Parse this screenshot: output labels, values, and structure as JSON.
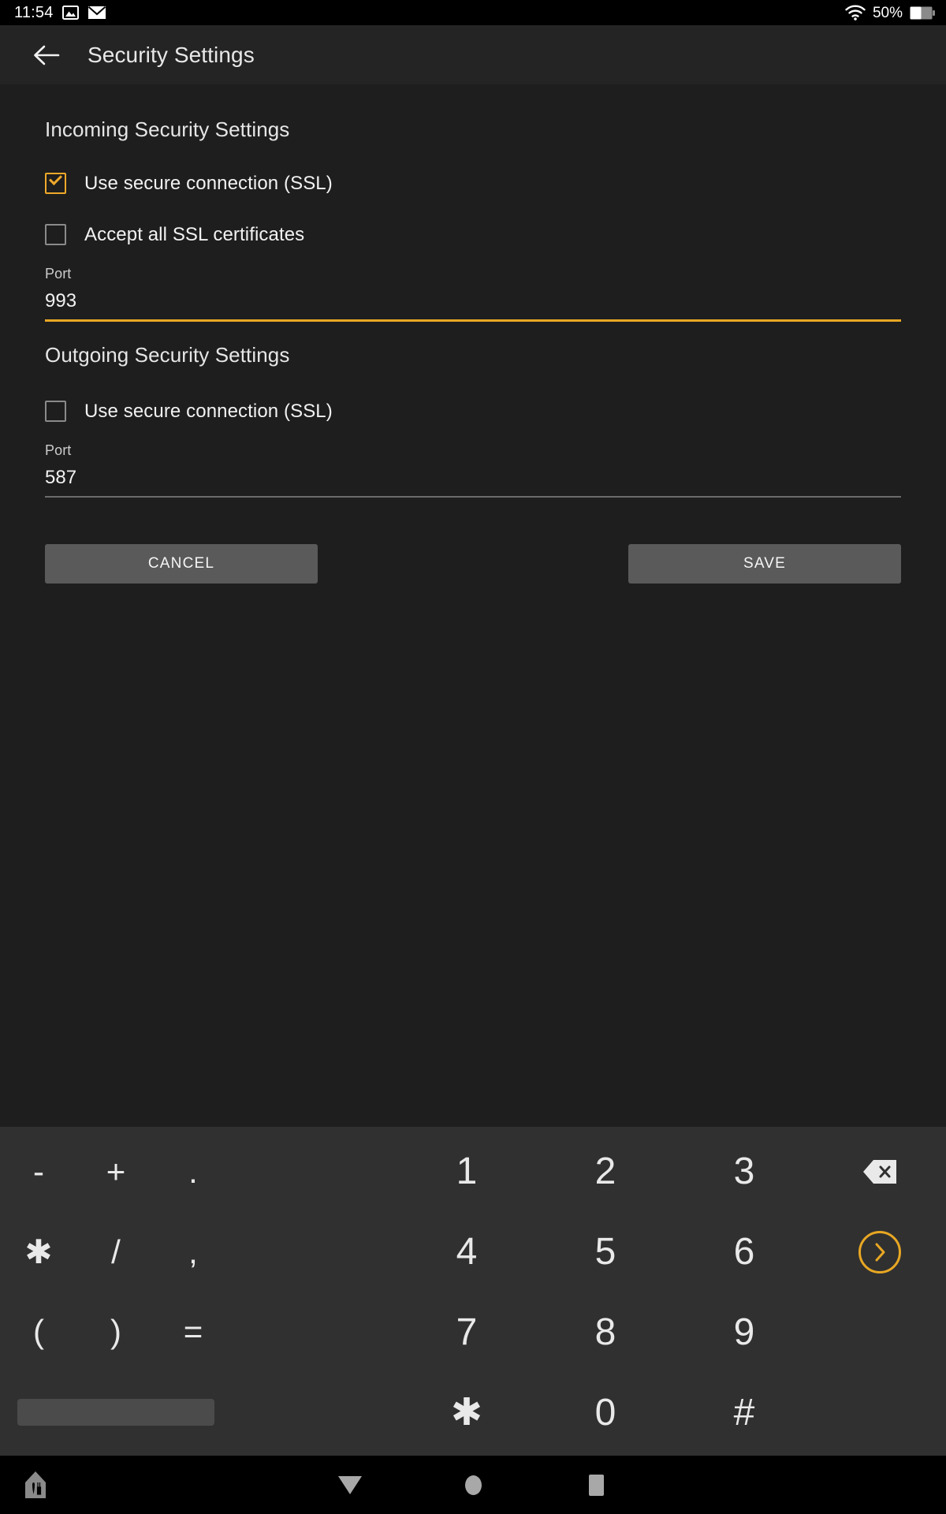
{
  "status_bar": {
    "clock": "11:54",
    "icons": [
      "image-icon",
      "mail-icon"
    ],
    "wifi_icon": "wifi-icon",
    "battery_percent": "50%",
    "battery_icon": "battery-half-icon"
  },
  "app_bar": {
    "back_icon": "arrow-left-icon",
    "title": "Security Settings"
  },
  "incoming": {
    "section_title": "Incoming Security Settings",
    "ssl_label": "Use secure connection (SSL)",
    "ssl_checked": true,
    "accept_certs_label": "Accept all SSL certificates",
    "accept_certs_checked": false,
    "port_label": "Port",
    "port_value": "993",
    "port_focused": true
  },
  "outgoing": {
    "section_title": "Outgoing Security Settings",
    "ssl_label": "Use secure connection (SSL)",
    "ssl_checked": false,
    "port_label": "Port",
    "port_value": "587",
    "port_focused": false
  },
  "actions": {
    "cancel_label": "CANCEL",
    "save_label": "SAVE"
  },
  "theme": {
    "accent": "#e8a723",
    "checkbox_accent": "#f0a92a",
    "background": "#1e1e1e",
    "app_bar_bg": "#242424",
    "keyboard_bg": "#303030",
    "button_bg": "#5a5a5a",
    "nav_bg": "#000000"
  },
  "keyboard": {
    "rows": [
      {
        "symbols": [
          "-",
          "+",
          "."
        ],
        "numbers": [
          "1",
          "2",
          "3"
        ],
        "function": "backspace-icon"
      },
      {
        "symbols": [
          "✱",
          "/",
          ","
        ],
        "numbers": [
          "4",
          "5",
          "6"
        ],
        "function": "enter-next-icon"
      },
      {
        "symbols": [
          "(",
          ")",
          "="
        ],
        "numbers": [
          "7",
          "8",
          "9"
        ],
        "function": ""
      },
      {
        "symbols": [
          "space"
        ],
        "numbers": [
          "✱",
          "0",
          "#"
        ],
        "function": ""
      }
    ]
  },
  "nav_bar": {
    "home_icon": "home-icon",
    "back_icon": "back-triangle-icon",
    "home_circle_icon": "home-circle-icon",
    "recents_icon": "recents-square-icon"
  }
}
